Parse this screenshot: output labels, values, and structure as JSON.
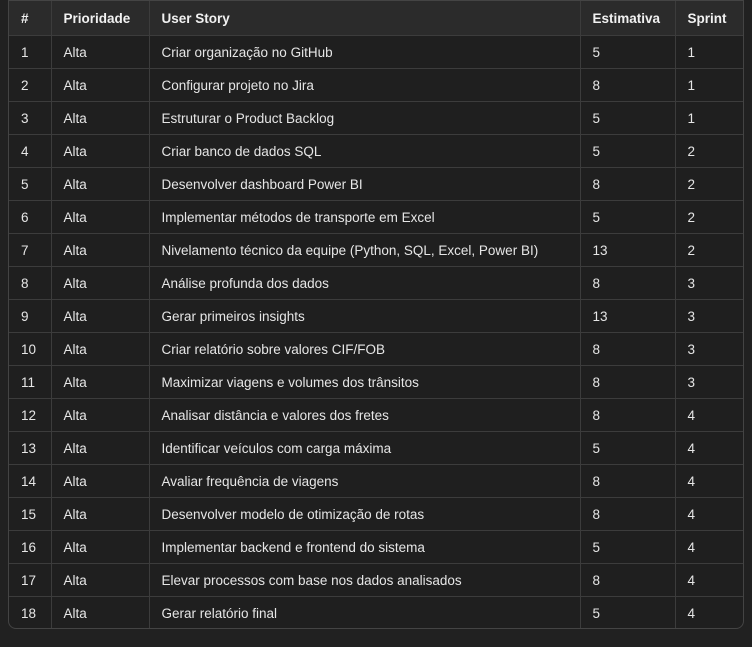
{
  "table": {
    "headers": [
      "#",
      "Prioridade",
      "User Story",
      "Estimativa",
      "Sprint"
    ],
    "rows": [
      [
        "1",
        "Alta",
        "Criar organização no GitHub",
        "5",
        "1"
      ],
      [
        "2",
        "Alta",
        "Configurar projeto no Jira",
        "8",
        "1"
      ],
      [
        "3",
        "Alta",
        "Estruturar o Product Backlog",
        "5",
        "1"
      ],
      [
        "4",
        "Alta",
        "Criar banco de dados SQL",
        "5",
        "2"
      ],
      [
        "5",
        "Alta",
        "Desenvolver dashboard Power BI",
        "8",
        "2"
      ],
      [
        "6",
        "Alta",
        "Implementar métodos de transporte em Excel",
        "5",
        "2"
      ],
      [
        "7",
        "Alta",
        "Nivelamento técnico da equipe (Python, SQL, Excel, Power BI)",
        "13",
        "2"
      ],
      [
        "8",
        "Alta",
        "Análise profunda dos dados",
        "8",
        "3"
      ],
      [
        "9",
        "Alta",
        "Gerar primeiros insights",
        "13",
        "3"
      ],
      [
        "10",
        "Alta",
        "Criar relatório sobre valores CIF/FOB",
        "8",
        "3"
      ],
      [
        "11",
        "Alta",
        "Maximizar viagens e volumes dos trânsitos",
        "8",
        "3"
      ],
      [
        "12",
        "Alta",
        "Analisar distância e valores dos fretes",
        "8",
        "4"
      ],
      [
        "13",
        "Alta",
        "Identificar veículos com carga máxima",
        "5",
        "4"
      ],
      [
        "14",
        "Alta",
        "Avaliar frequência de viagens",
        "8",
        "4"
      ],
      [
        "15",
        "Alta",
        "Desenvolver modelo de otimização de rotas",
        "8",
        "4"
      ],
      [
        "16",
        "Alta",
        "Implementar backend e frontend do sistema",
        "5",
        "4"
      ],
      [
        "17",
        "Alta",
        "Elevar processos com base nos dados analisados",
        "8",
        "4"
      ],
      [
        "18",
        "Alta",
        "Gerar relatório final",
        "5",
        "4"
      ]
    ]
  }
}
